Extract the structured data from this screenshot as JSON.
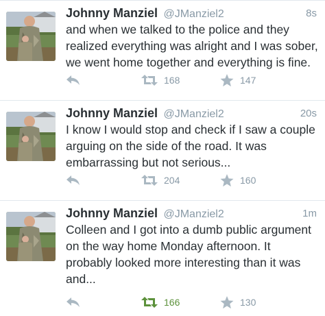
{
  "colors": {
    "text": "#292f33",
    "muted": "#8899a6",
    "divider": "#e1e8ed",
    "icon": "#aab8c2",
    "retweeted": "#5c913b"
  },
  "tweets": [
    {
      "name": "Johnny Manziel",
      "handle": "@JManziel2",
      "time": "8s",
      "text": "and when we talked to the police and they realized everything was alright and I was sober, we went home together and everything is fine.",
      "retweets": "168",
      "favorites": "147",
      "retweeted": false
    },
    {
      "name": "Johnny Manziel",
      "handle": "@JManziel2",
      "time": "20s",
      "text": "I know I would stop and check if I saw a couple arguing on the side of the road.  It was embarrassing but not serious...",
      "retweets": "204",
      "favorites": "160",
      "retweeted": false
    },
    {
      "name": "Johnny Manziel",
      "handle": "@JManziel2",
      "time": "1m",
      "text": "Colleen and I got into a dumb public argument on the way home Monday afternoon.  It probably looked more interesting than it was and...",
      "retweets": "166",
      "favorites": "130",
      "retweeted": true
    }
  ]
}
